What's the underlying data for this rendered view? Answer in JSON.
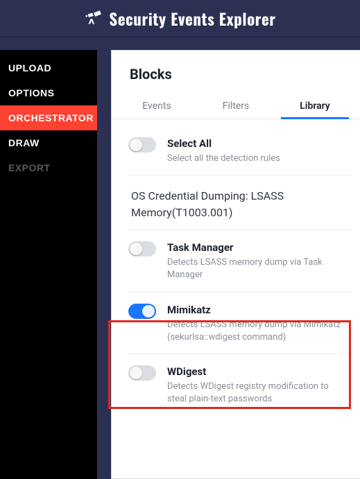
{
  "header": {
    "title": "Security Events Explorer"
  },
  "sidebar": {
    "items": [
      {
        "label": "UPLOAD",
        "state": "normal"
      },
      {
        "label": "OPTIONS",
        "state": "normal"
      },
      {
        "label": "ORCHESTRATOR",
        "state": "active"
      },
      {
        "label": "DRAW",
        "state": "normal"
      },
      {
        "label": "EXPORT",
        "state": "disabled"
      }
    ]
  },
  "panel": {
    "title": "Blocks",
    "tabs": [
      {
        "label": "Events",
        "active": false
      },
      {
        "label": "Filters",
        "active": false
      },
      {
        "label": "Library",
        "active": true
      }
    ],
    "select_all": {
      "title": "Select All",
      "desc": "Select all the detection rules",
      "on": false
    },
    "group_heading": "OS Credential Dumping: LSASS Memory(T1003.001)",
    "rules": [
      {
        "title": "Task Manager",
        "desc": "Detects LSASS memory dump via Task Manager",
        "on": false
      },
      {
        "title": "Mimikatz",
        "desc": "Detects LSASS memory dump via Mimikatz (sekurlsa::wdigest command)",
        "on": true
      },
      {
        "title": "WDigest",
        "desc": "Detects WDigest registry modification to steal plain-text passwords",
        "on": false
      }
    ]
  }
}
